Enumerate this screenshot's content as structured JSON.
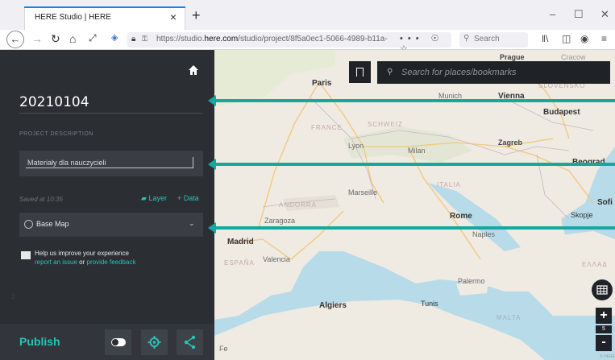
{
  "browser": {
    "tab_title": "HERE Studio | HERE",
    "tab_close": "×",
    "new_tab": "+",
    "url_prefix": "https://studio.",
    "url_domain": "here.com",
    "url_path": "/studio/project/8f5a0ec1-5066-4989-b11a-",
    "url_actions": "••• ☉ ☆",
    "search_placeholder": "Search",
    "minimize": "–",
    "maximize": "☐",
    "close": "✕"
  },
  "sidebar": {
    "project_title": "20210104",
    "description_label": "PROJECT DESCRIPTION",
    "description_value": "Materiały dla nauczycieli",
    "saved_label": "Saved at 10:35",
    "layer_button": "Layer",
    "data_button": "+ Data",
    "basemap_label": "Base Map",
    "feedback_title": "Help us improve your experience",
    "feedback_link1": "report an issue",
    "feedback_or": "or",
    "feedback_link2": "provide feedback",
    "faint_number": "2",
    "publish_label": "Publish"
  },
  "map": {
    "search_placeholder": "Search for places/bookmarks",
    "zoom_in": "+",
    "zoom_level": "5",
    "zoom_out": "-",
    "labels": {
      "prague": "Prague",
      "cracow": "Cracow",
      "paris": "Paris",
      "munich": "Munich",
      "vienna": "Vienna",
      "slovensko": "SLOVENSKO",
      "budapest": "Budapest",
      "france": "FRANCE",
      "schweiz": "SCHWEIZ",
      "lyon": "Lyon",
      "milan": "Milan",
      "zagreb": "Zagreb",
      "beograd": "Beograd",
      "marseille": "Marseille",
      "italia": "ITALIA",
      "andorra": "ANDORRA",
      "sofia": "Sofi",
      "zaragoza": "Zaragoza",
      "rome": "Rome",
      "skopje": "Skopje",
      "madrid": "Madrid",
      "naples": "Naples",
      "espana": "ESPAÑA",
      "valencia": "Valencia",
      "ellada": "ΕΛΛΑΔ",
      "palermo": "Palermo",
      "algiers": "Algiers",
      "tunis": "Tunis",
      "malta": "MALTA",
      "fe": "Fe"
    },
    "copyright": "© HERE"
  }
}
